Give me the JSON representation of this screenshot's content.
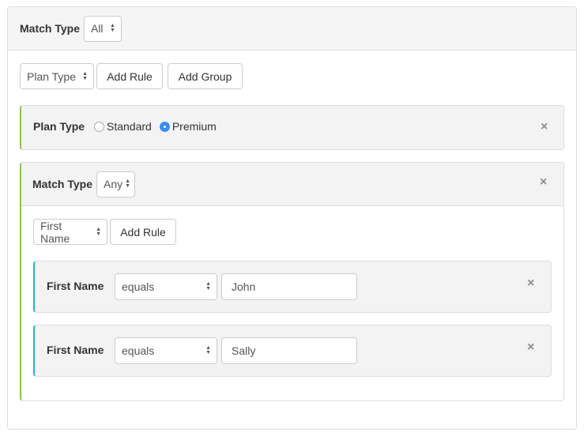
{
  "root": {
    "match_type_label": "Match Type",
    "match_type_value": "All",
    "field_select_value": "Plan Type",
    "add_rule_label": "Add Rule",
    "add_group_label": "Add Group"
  },
  "plan_rule": {
    "label": "Plan Type",
    "options": [
      {
        "label": "Standard",
        "checked": false
      },
      {
        "label": "Premium",
        "checked": true
      }
    ],
    "close_icon": "×"
  },
  "group": {
    "match_type_label": "Match Type",
    "match_type_value": "Any",
    "field_select_value": "First Name",
    "add_rule_label": "Add Rule",
    "close_icon": "×",
    "rules": [
      {
        "label": "First Name",
        "operator": "equals",
        "value": "John",
        "close_icon": "×"
      },
      {
        "label": "First Name",
        "operator": "equals",
        "value": "Sally",
        "close_icon": "×"
      }
    ]
  },
  "colors": {
    "group_accent": "#8cc152",
    "rule_accent": "#1fb5d4",
    "radio_selected": "#3b8ef0"
  }
}
